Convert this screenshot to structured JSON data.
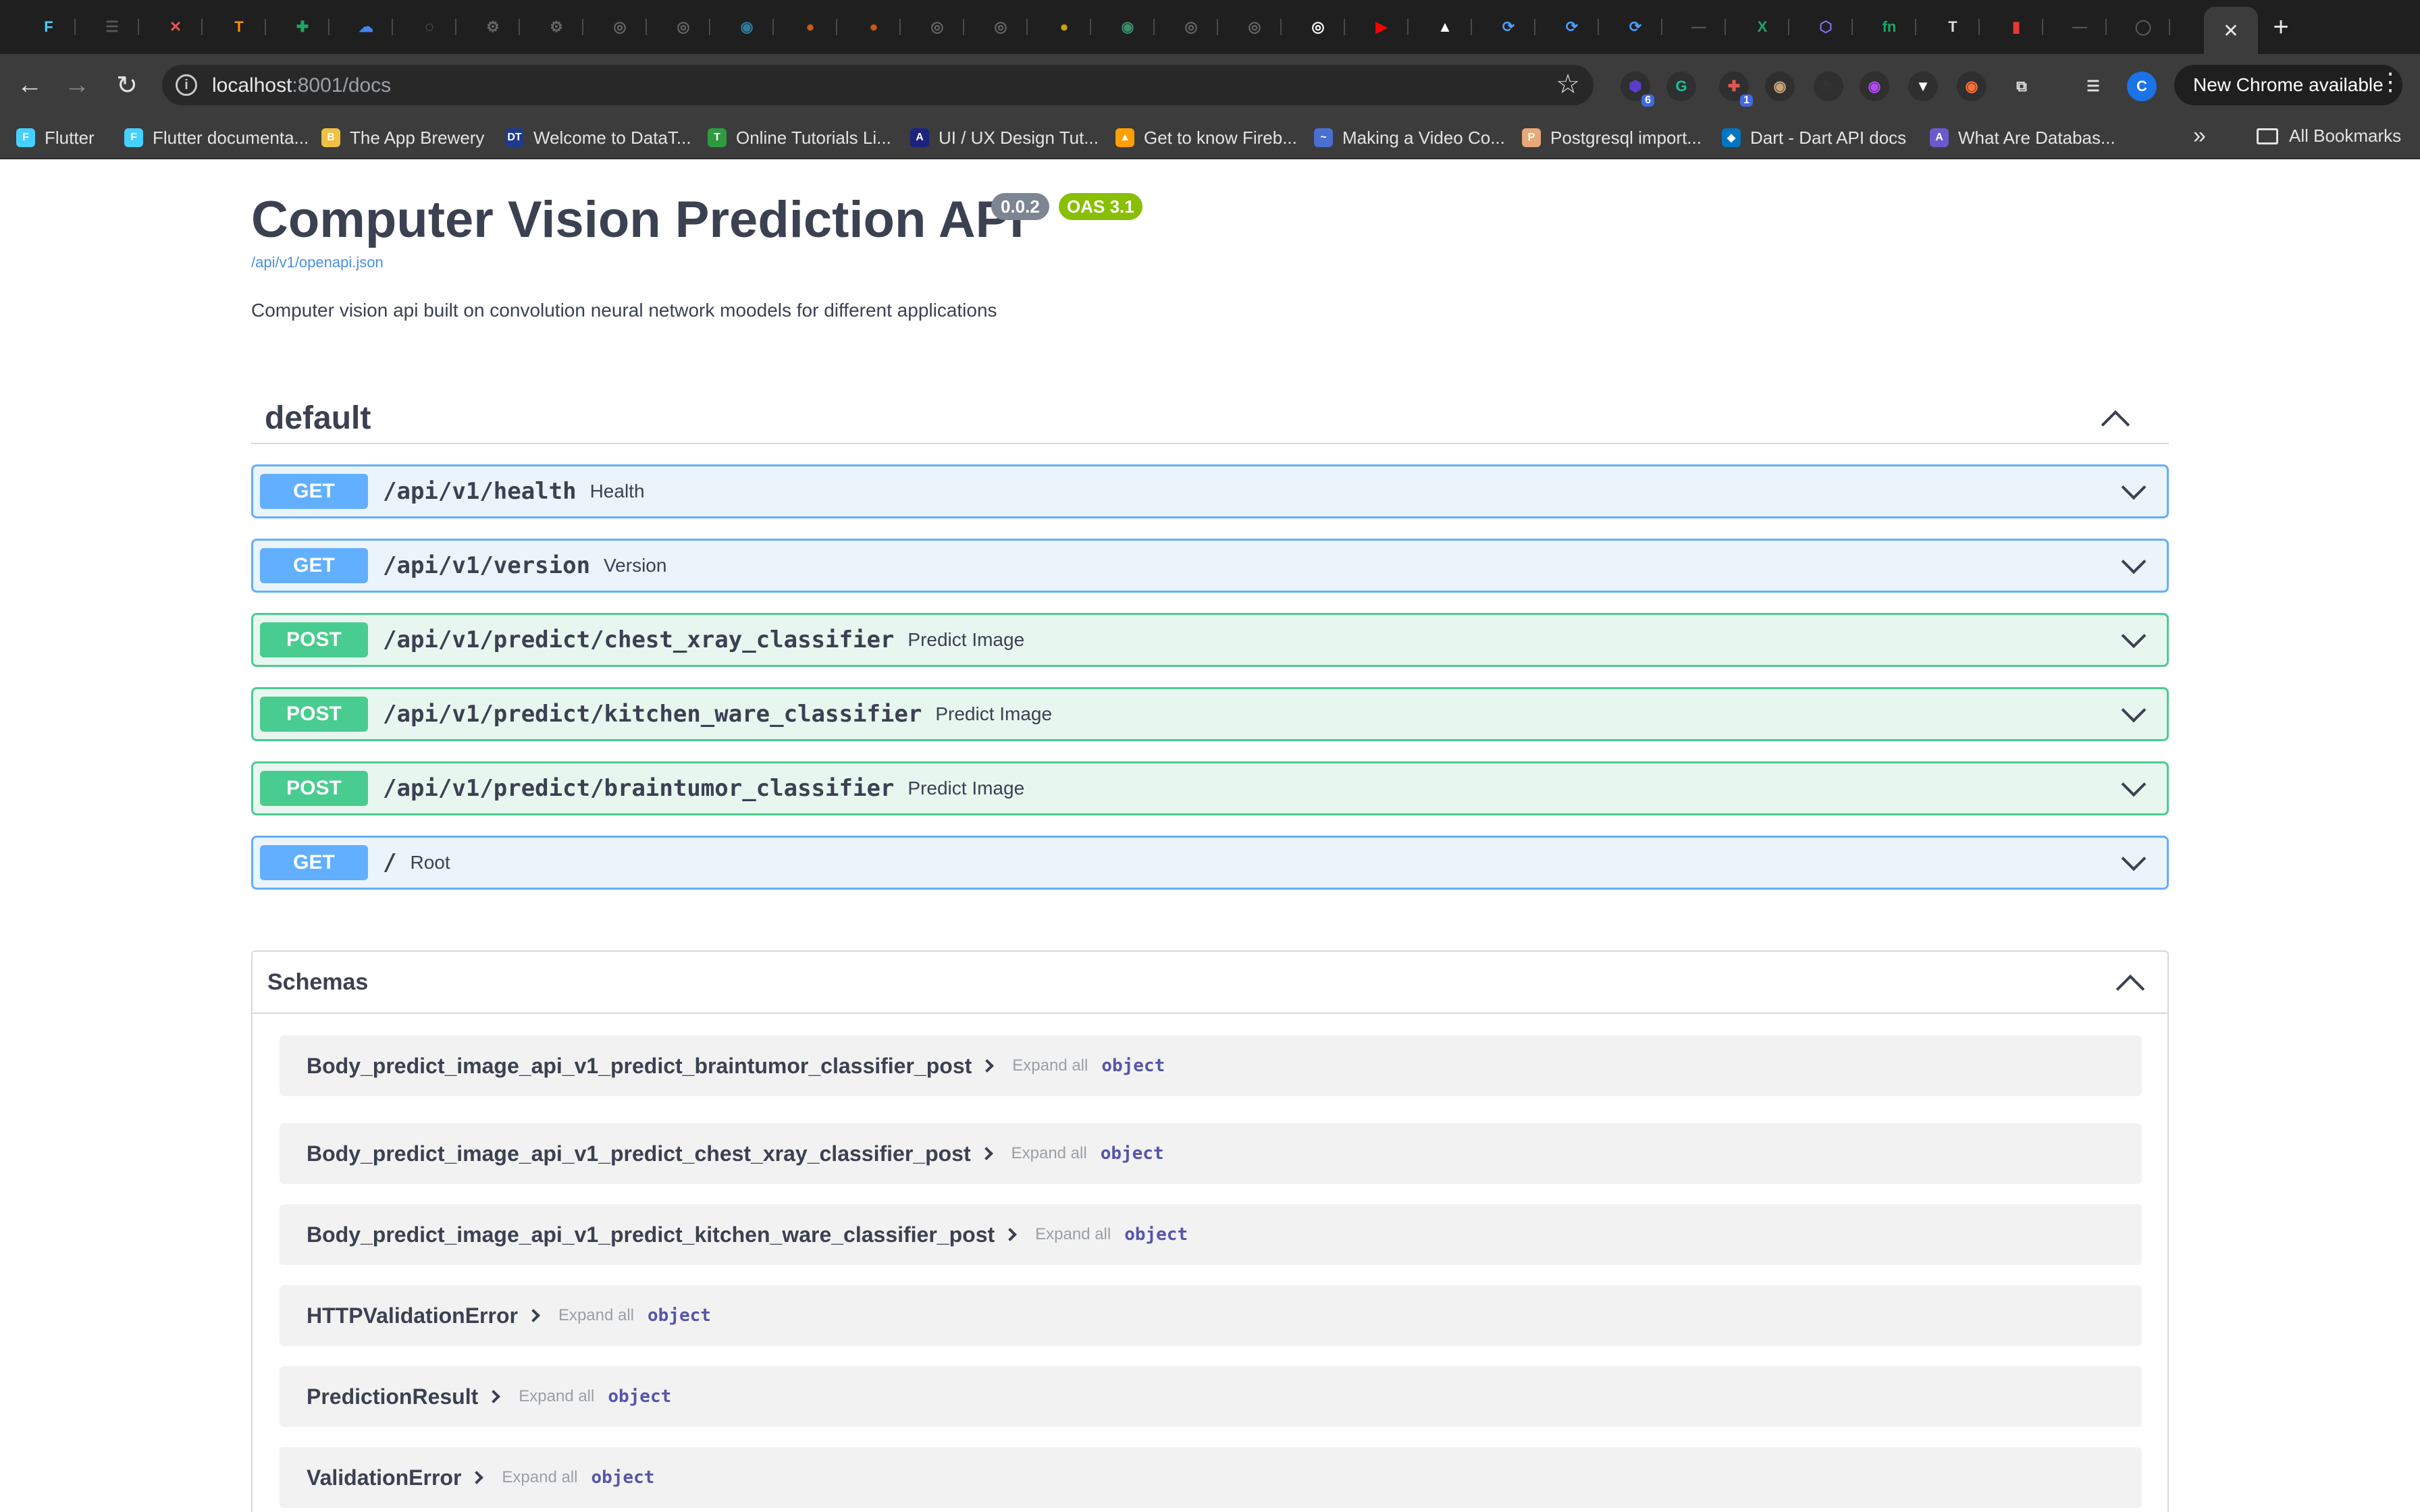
{
  "browser": {
    "tabs": [
      {
        "icon": "flutter-icon",
        "glyph": "F",
        "color": "#45d1fd"
      },
      {
        "icon": "menu-icon",
        "glyph": "☰",
        "color": "#555555"
      },
      {
        "icon": "cross-icon",
        "glyph": "✕",
        "color": "#e0574f"
      },
      {
        "icon": "tensorflow-icon",
        "glyph": "T",
        "color": "#ff8f00"
      },
      {
        "icon": "plus-leaf-icon",
        "glyph": "✚",
        "color": "#1fa463"
      },
      {
        "icon": "cloud-icon",
        "glyph": "☁",
        "color": "#4285f4"
      },
      {
        "icon": "circle-icon",
        "glyph": "◌",
        "color": "#777777"
      },
      {
        "icon": "gear-site-icon",
        "glyph": "⚙",
        "color": "#666666"
      },
      {
        "icon": "gear-site-icon",
        "glyph": "⚙",
        "color": "#666666"
      },
      {
        "icon": "openai-icon",
        "glyph": "◎",
        "color": "#666666"
      },
      {
        "icon": "openai-icon",
        "glyph": "◎",
        "color": "#666666"
      },
      {
        "icon": "globe-icon",
        "glyph": "◉",
        "color": "#2e7d9a"
      },
      {
        "icon": "fire-icon",
        "glyph": "●",
        "color": "#c75b12"
      },
      {
        "icon": "fire-icon",
        "glyph": "●",
        "color": "#c75b12"
      },
      {
        "icon": "openai-icon",
        "glyph": "◎",
        "color": "#666666"
      },
      {
        "icon": "openai-icon",
        "glyph": "◎",
        "color": "#666666"
      },
      {
        "icon": "medal-icon",
        "glyph": "●",
        "color": "#c7a114"
      },
      {
        "icon": "globe-icon",
        "glyph": "◉",
        "color": "#3a8f6a"
      },
      {
        "icon": "openai-icon",
        "glyph": "◎",
        "color": "#666666"
      },
      {
        "icon": "openai-icon",
        "glyph": "◎",
        "color": "#666666"
      },
      {
        "icon": "openai-icon",
        "glyph": "◎",
        "color": "#ffffff"
      },
      {
        "icon": "youtube-icon",
        "glyph": "▶",
        "color": "#ff0000"
      },
      {
        "icon": "triangle-icon",
        "glyph": "▲",
        "color": "#ffffff"
      },
      {
        "icon": "sync-icon",
        "glyph": "⟳",
        "color": "#4a9eff"
      },
      {
        "icon": "sync-icon",
        "glyph": "⟳",
        "color": "#4a9eff"
      },
      {
        "icon": "sync-icon",
        "glyph": "⟳",
        "color": "#4a9eff"
      },
      {
        "icon": "dash-icon",
        "glyph": "—",
        "color": "#555555"
      },
      {
        "icon": "excel-icon",
        "glyph": "X",
        "color": "#21a366"
      },
      {
        "icon": "cube-icon",
        "glyph": "⬡",
        "color": "#8a6ff0"
      },
      {
        "icon": "fn-icon",
        "glyph": "fn",
        "color": "#1fa463"
      },
      {
        "icon": "tensor-icon",
        "glyph": "T",
        "color": "#dddddd"
      },
      {
        "icon": "bar-chart-icon",
        "glyph": "▮",
        "color": "#e53935"
      },
      {
        "icon": "dash-icon",
        "glyph": "—",
        "color": "#555555"
      },
      {
        "icon": "github-icon",
        "glyph": "◯",
        "color": "#555555"
      }
    ],
    "new_tab": "+",
    "url_host": "localhost",
    "url_rest": ":8001/docs",
    "update_button": "New Chrome available",
    "extensions": [
      {
        "icon": "extension-icon",
        "glyph": "⬢",
        "color": "#5b3ec8",
        "badge": "6"
      },
      {
        "icon": "grammarly-icon",
        "glyph": "G",
        "color": "#15c39a",
        "badge": ""
      },
      {
        "icon": "extension-icon",
        "glyph": "✚",
        "color": "#e0574f",
        "badge": "1"
      },
      {
        "icon": "owl-icon",
        "glyph": "◉",
        "color": "#c7a57a",
        "badge": ""
      },
      {
        "icon": "pen-icon",
        "glyph": "✎",
        "color": "#333333",
        "badge": ""
      },
      {
        "icon": "extension-icon",
        "glyph": "◉",
        "color": "#b24bf3",
        "badge": ""
      },
      {
        "icon": "shop-icon",
        "glyph": "▼",
        "color": "#ffffff",
        "badge": ""
      },
      {
        "icon": "firefox-icon",
        "glyph": "◉",
        "color": "#ff7139",
        "badge": ""
      },
      {
        "icon": "puzzle-icon",
        "glyph": "⧉",
        "color": "#e3e3e3",
        "badge": ""
      },
      {
        "icon": "media-icon",
        "glyph": "☰",
        "color": "#e3e3e3",
        "badge": ""
      },
      {
        "icon": "profile-icon",
        "glyph": "C",
        "color": "#1a73e8",
        "badge": ""
      }
    ],
    "bookmarks": [
      {
        "label": "Flutter",
        "icon": "flutter-icon",
        "glyph": "F",
        "color": "#45d1fd"
      },
      {
        "label": "Flutter documenta...",
        "icon": "flutter-icon",
        "glyph": "F",
        "color": "#45d1fd"
      },
      {
        "label": "The App Brewery",
        "icon": "brewery-icon",
        "glyph": "B",
        "color": "#f0c040"
      },
      {
        "label": "Welcome to DataT...",
        "icon": "datatables-icon",
        "glyph": "DT",
        "color": "#1f3a8a"
      },
      {
        "label": "Online Tutorials Li...",
        "icon": "tutorials-icon",
        "glyph": "T",
        "color": "#2e9b40"
      },
      {
        "label": "UI / UX Design Tut...",
        "icon": "design-icon",
        "glyph": "A",
        "color": "#1a237e"
      },
      {
        "label": "Get to know Fireb...",
        "icon": "firebase-icon",
        "glyph": "▲",
        "color": "#ffa000"
      },
      {
        "label": "Making a Video Co...",
        "icon": "video-icon",
        "glyph": "~",
        "color": "#4a6fd1"
      },
      {
        "label": "Postgresql import...",
        "icon": "postgres-icon",
        "glyph": "P",
        "color": "#e8a878"
      },
      {
        "label": "Dart - Dart API docs",
        "icon": "dart-icon",
        "glyph": "◆",
        "color": "#0175c2"
      },
      {
        "label": "What Are Databas...",
        "icon": "database-icon",
        "glyph": "A",
        "color": "#6a5acd"
      }
    ],
    "more_bookmarks": "»",
    "all_bookmarks": "All Bookmarks"
  },
  "swagger": {
    "title": "Computer Vision Prediction API",
    "version": "0.0.2",
    "oas": "OAS 3.1",
    "openapi_link": "/api/v1/openapi.json",
    "description": "Computer vision api built on convolution neural network moodels for different applications",
    "section": "default",
    "operations": [
      {
        "method": "GET",
        "path": "/api/v1/health",
        "summary": "Health"
      },
      {
        "method": "GET",
        "path": "/api/v1/version",
        "summary": "Version"
      },
      {
        "method": "POST",
        "path": "/api/v1/predict/chest_xray_classifier",
        "summary": "Predict Image"
      },
      {
        "method": "POST",
        "path": "/api/v1/predict/kitchen_ware_classifier",
        "summary": "Predict Image"
      },
      {
        "method": "POST",
        "path": "/api/v1/predict/braintumor_classifier",
        "summary": "Predict Image"
      },
      {
        "method": "GET",
        "path": "/",
        "summary": "Root"
      }
    ],
    "schemas_label": "Schemas",
    "models": [
      {
        "name": "Body_predict_image_api_v1_predict_braintumor_classifier_post",
        "expand": "Expand all",
        "type": "object"
      },
      {
        "name": "Body_predict_image_api_v1_predict_chest_xray_classifier_post",
        "expand": "Expand all",
        "type": "object"
      },
      {
        "name": "Body_predict_image_api_v1_predict_kitchen_ware_classifier_post",
        "expand": "Expand all",
        "type": "object"
      },
      {
        "name": "HTTPValidationError",
        "expand": "Expand all",
        "type": "object"
      },
      {
        "name": "PredictionResult",
        "expand": "Expand all",
        "type": "object"
      },
      {
        "name": "ValidationError",
        "expand": "Expand all",
        "type": "object"
      }
    ]
  }
}
